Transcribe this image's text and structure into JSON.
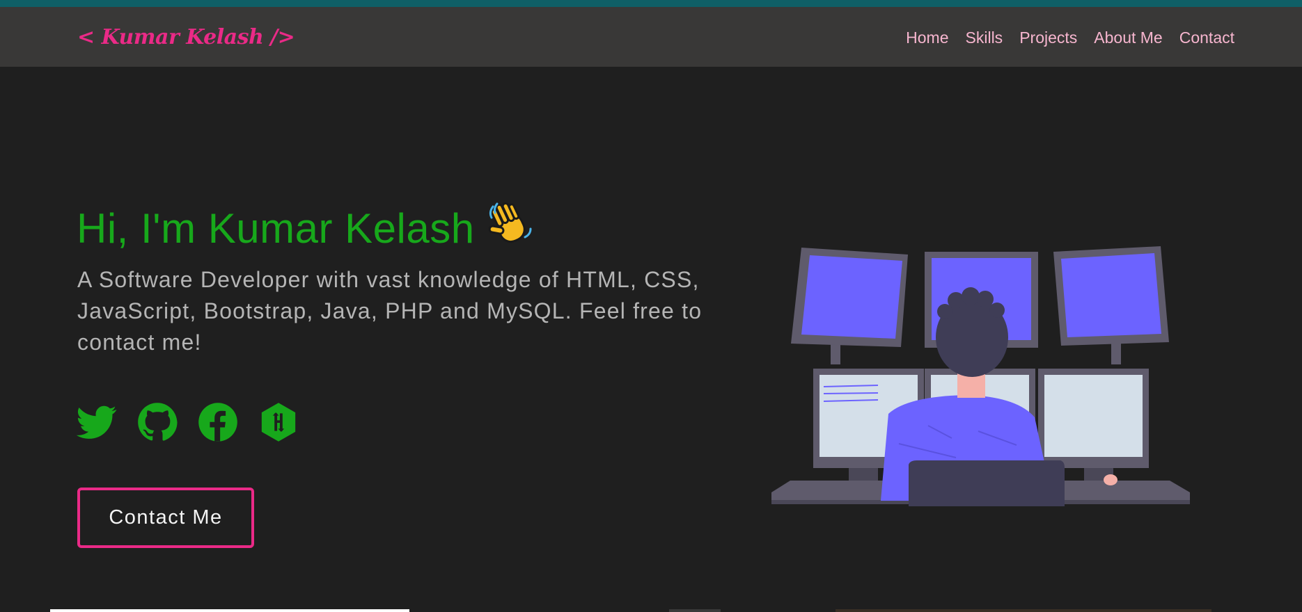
{
  "nav": {
    "logo": "< Kumar Kelash />",
    "links": [
      "Home",
      "Skills",
      "Projects",
      "About Me",
      "Contact"
    ]
  },
  "hero": {
    "heading": "Hi, I'm Kumar Kelash",
    "wave_icon": "waving-hand-icon",
    "description": "A Software Developer with vast knowledge of HTML, CSS, JavaScript, Bootstrap, Java, PHP and MySQL. Feel free to contact me!",
    "contact_button": "Contact Me"
  },
  "socials": [
    {
      "icon": "twitter-icon"
    },
    {
      "icon": "github-icon"
    },
    {
      "icon": "facebook-icon"
    },
    {
      "icon": "hackerrank-icon"
    }
  ],
  "colors": {
    "background": "#1f1f1f",
    "navbar": "#393837",
    "accent_pink": "#ea2a87",
    "nav_link": "#f7b6cf",
    "heading_green": "#17a81b",
    "text_gray": "#b5b5b5",
    "illustration_purple": "#6c63ff"
  }
}
